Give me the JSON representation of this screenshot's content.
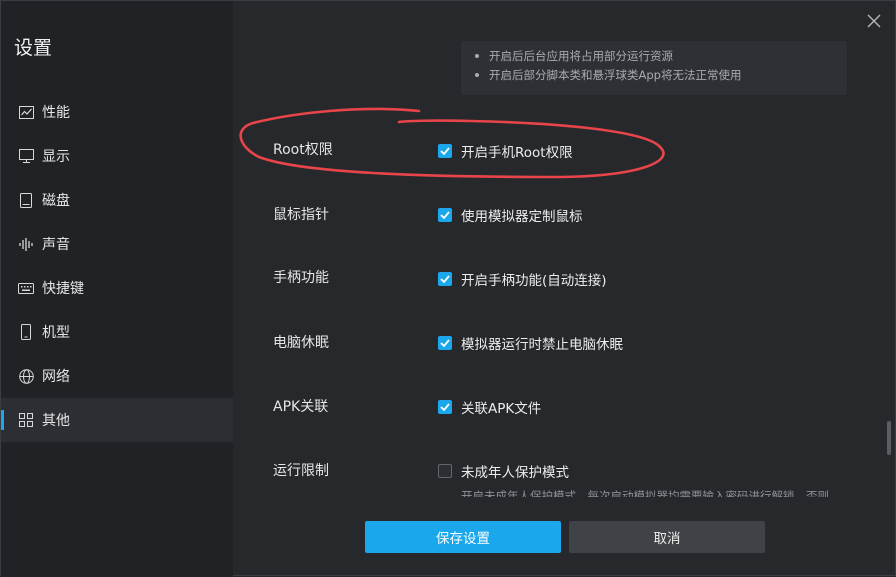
{
  "sidebar": {
    "title": "设置",
    "items": [
      {
        "label": "性能",
        "icon": "chart-line-icon",
        "active": false
      },
      {
        "label": "显示",
        "icon": "monitor-icon",
        "active": false
      },
      {
        "label": "磁盘",
        "icon": "disk-icon",
        "active": false
      },
      {
        "label": "声音",
        "icon": "sound-wave-icon",
        "active": false
      },
      {
        "label": "快捷键",
        "icon": "keyboard-icon",
        "active": false
      },
      {
        "label": "机型",
        "icon": "phone-icon",
        "active": false
      },
      {
        "label": "网络",
        "icon": "globe-icon",
        "active": false
      },
      {
        "label": "其他",
        "icon": "grid-icon",
        "active": true
      }
    ]
  },
  "notes": [
    "开启后后台应用将占用部分运行资源",
    "开启后部分脚本类和悬浮球类App将无法正常使用"
  ],
  "settings": [
    {
      "label": "Root权限",
      "option": "开启手机Root权限",
      "checked": true
    },
    {
      "label": "鼠标指针",
      "option": "使用模拟器定制鼠标",
      "checked": true
    },
    {
      "label": "手柄功能",
      "option": "开启手柄功能(自动连接)",
      "checked": true
    },
    {
      "label": "电脑休眠",
      "option": "模拟器运行时禁止电脑休眠",
      "checked": true
    },
    {
      "label": "APK关联",
      "option": "关联APK文件",
      "checked": true
    },
    {
      "label": "运行限制",
      "option": "未成年人保护模式",
      "checked": false
    }
  ],
  "run_limit_desc": "开启未成年人保护模式，每次启动模拟器均需要输入密码进行解锁，否则",
  "buttons": {
    "save": "保存设置",
    "cancel": "取消"
  },
  "colors": {
    "accent": "#1aa7ec",
    "annotation": "#e8454a"
  }
}
